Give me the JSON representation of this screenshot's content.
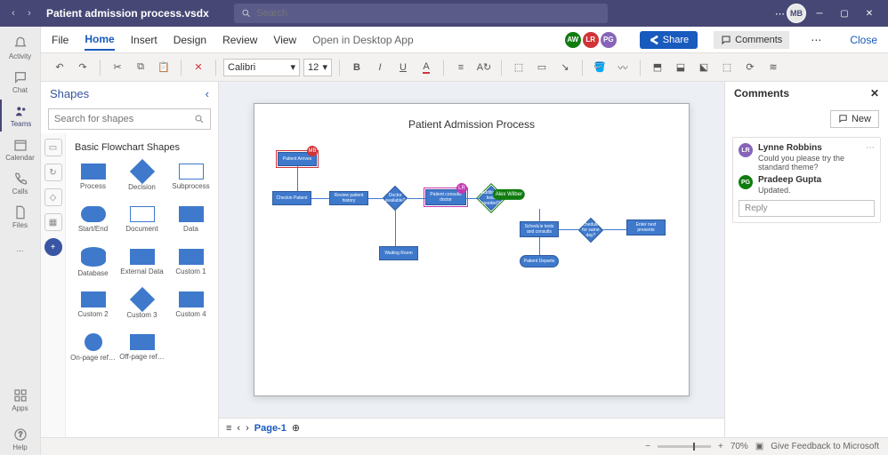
{
  "titlebar": {
    "filename": "Patient admission process.vsdx",
    "search_placeholder": "Search",
    "avatar": "MB"
  },
  "rail": {
    "activity": "Activity",
    "chat": "Chat",
    "teams": "Teams",
    "calendar": "Calendar",
    "calls": "Calls",
    "files": "Files",
    "apps": "Apps",
    "help": "Help"
  },
  "ribbon": {
    "file": "File",
    "home": "Home",
    "insert": "Insert",
    "design": "Design",
    "review": "Review",
    "view": "View",
    "desktop": "Open in Desktop App",
    "share": "Share",
    "comments": "Comments",
    "close": "Close"
  },
  "presence": [
    {
      "initials": "AW",
      "color": "#107c10"
    },
    {
      "initials": "LR",
      "color": "#d13438"
    },
    {
      "initials": "PG",
      "color": "#8764b8"
    }
  ],
  "toolbar": {
    "font": "Calibri",
    "size": "12"
  },
  "shapes": {
    "title": "Shapes",
    "search_placeholder": "Search for shapes",
    "group": "Basic Flowchart Shapes",
    "items": [
      {
        "name": "Process",
        "kind": "rect"
      },
      {
        "name": "Decision",
        "kind": "diamond"
      },
      {
        "name": "Subprocess",
        "kind": "doc"
      },
      {
        "name": "Start/End",
        "kind": "rounded"
      },
      {
        "name": "Document",
        "kind": "doc"
      },
      {
        "name": "Data",
        "kind": "rect"
      },
      {
        "name": "Database",
        "kind": "db"
      },
      {
        "name": "External Data",
        "kind": "rect"
      },
      {
        "name": "Custom 1",
        "kind": "rect"
      },
      {
        "name": "Custom 2",
        "kind": "rect"
      },
      {
        "name": "Custom 3",
        "kind": "diamond"
      },
      {
        "name": "Custom 4",
        "kind": "rect"
      },
      {
        "name": "On-page ref…",
        "kind": "circ"
      },
      {
        "name": "Off-page ref…",
        "kind": "rect"
      }
    ]
  },
  "diagram": {
    "title": "Patient Admission Process",
    "nodes": {
      "n1": {
        "label": "Patient Arrives",
        "badge": "MB",
        "badgeColor": "#d13438"
      },
      "n2": {
        "label": "Checkin Patient"
      },
      "n3": {
        "label": "Review patient history"
      },
      "n4": {
        "label": "Doctor available?"
      },
      "n5": {
        "label": "Patient consults doctor",
        "badge": "LR",
        "badgeColor": "#c239b3"
      },
      "n6": {
        "label": "Additional tests needed?",
        "badge": "Alex Wilber"
      },
      "n7": {
        "label": "Waiting Room"
      },
      "n8": {
        "label": "Schedule tests and consults"
      },
      "n9": {
        "label": "Scheduled for same day?"
      },
      "n10": {
        "label": "Enter next presents"
      },
      "n11": {
        "label": "Patient Departs"
      }
    }
  },
  "comments": {
    "title": "Comments",
    "new": "New",
    "reply": "Reply",
    "thread": [
      {
        "initials": "LR",
        "color": "#8764b8",
        "name": "Lynne Robbins",
        "text": "Could you please try the standard theme?"
      },
      {
        "initials": "PG",
        "color": "#107c10",
        "name": "Pradeep Gupta",
        "text": "Updated."
      }
    ]
  },
  "pagebar": {
    "page": "Page-1"
  },
  "status": {
    "zoom": "70%",
    "feedback": "Give Feedback to Microsoft"
  }
}
